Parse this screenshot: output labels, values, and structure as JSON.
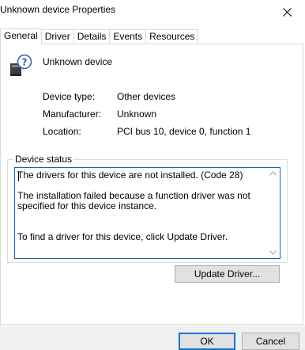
{
  "window": {
    "title": "Unknown device Properties"
  },
  "tabs": [
    {
      "label": "General",
      "active": true
    },
    {
      "label": "Driver",
      "active": false
    },
    {
      "label": "Details",
      "active": false
    },
    {
      "label": "Events",
      "active": false
    },
    {
      "label": "Resources",
      "active": false
    }
  ],
  "device": {
    "icon": "unknown-device-icon",
    "name": "Unknown device",
    "properties": [
      {
        "label": "Device type:",
        "value": "Other devices"
      },
      {
        "label": "Manufacturer:",
        "value": "Unknown"
      },
      {
        "label": "Location:",
        "value": "PCI bus 10, device 0, function 1"
      }
    ]
  },
  "status": {
    "legend": "Device status",
    "line1": "The drivers for this device are not installed. (Code 28)",
    "line2": "The installation failed because a function driver was not specified for this device instance.",
    "line3": "To find a driver for this device, click Update Driver."
  },
  "buttons": {
    "update_driver": "Update Driver...",
    "ok": "OK",
    "cancel": "Cancel"
  },
  "colors": {
    "focus_border": "#0f68b8",
    "default_button_border": "#0078d7",
    "button_face": "#e1e1e1"
  }
}
